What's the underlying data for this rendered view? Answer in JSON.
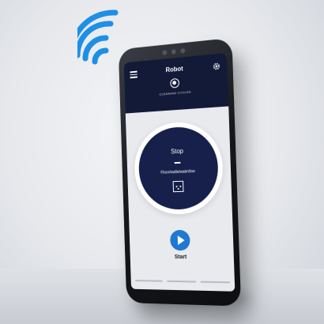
{
  "app": {
    "title": "Robot",
    "mode_label": "CLEANING CYCLES"
  },
  "main": {
    "status": "Stop",
    "mode": "Floor/walls/waterline"
  },
  "controls": {
    "start_label": "Start"
  },
  "colors": {
    "header": "#121a38",
    "disc": "#16204a",
    "accent": "#1f78d1",
    "wifi": "#1e8fe6"
  },
  "icons": [
    "wifi-icon",
    "menu-icon",
    "gear-icon",
    "cleaning-mode-icon",
    "floor-walls-icon",
    "play-icon"
  ]
}
